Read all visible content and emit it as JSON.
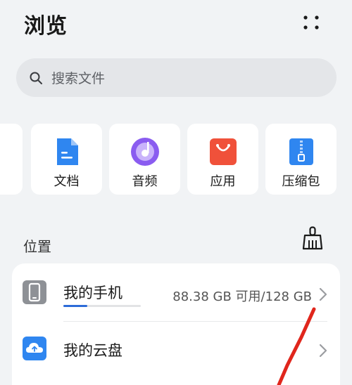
{
  "header": {
    "title": "浏览",
    "more_icon": "more-dots-icon"
  },
  "search": {
    "placeholder": "搜索文件",
    "icon": "search-icon"
  },
  "categories": [
    {
      "label": "文档",
      "icon": "document-icon",
      "color": "#2f86f0"
    },
    {
      "label": "音频",
      "icon": "audio-icon",
      "color": "#8a5cf0"
    },
    {
      "label": "应用",
      "icon": "app-store-icon",
      "color": "#f0513a"
    },
    {
      "label": "压缩包",
      "icon": "zip-archive-icon",
      "color": "#2f86f0"
    }
  ],
  "locations": {
    "title": "位置",
    "clean_icon": "broom-clean-icon",
    "items": [
      {
        "name": "我的手机",
        "detail": "88.38 GB 可用/128 GB",
        "icon": "phone-icon",
        "icon_color": "#8e9196",
        "used_fraction": 0.31
      },
      {
        "name": "我的云盘",
        "icon": "cloud-drive-icon",
        "icon_color": "#2f86f0"
      }
    ]
  },
  "colors": {
    "background": "#f1f3f5",
    "card": "#ffffff",
    "accent": "#2d6bd8",
    "annotation_stroke": "#e0261c"
  }
}
